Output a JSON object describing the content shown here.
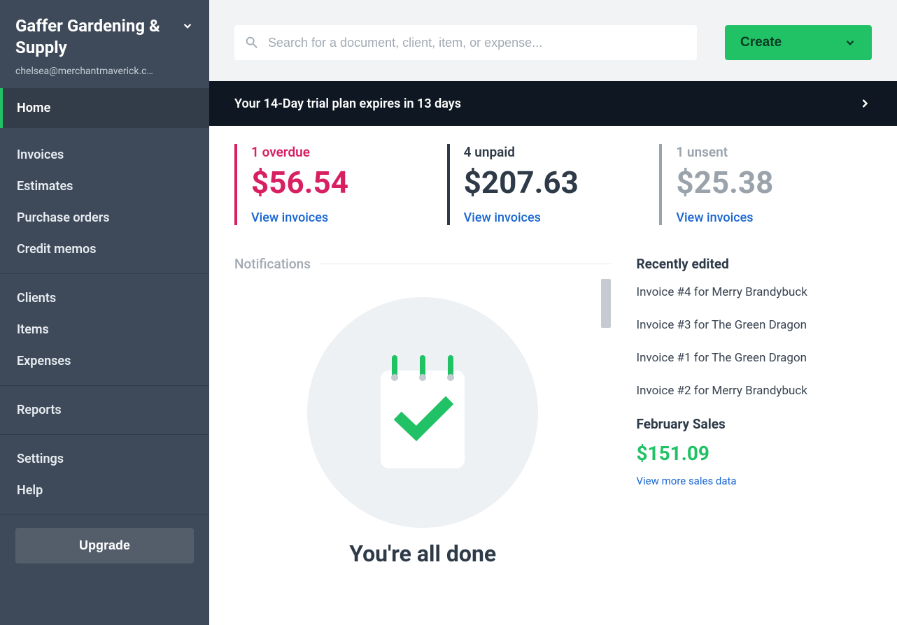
{
  "sidebar": {
    "company": "Gaffer Gardening & Supply",
    "email": "chelsea@merchantmaverick.c…",
    "nav": {
      "home": "Home",
      "invoices": "Invoices",
      "estimates": "Estimates",
      "purchase_orders": "Purchase orders",
      "credit_memos": "Credit memos",
      "clients": "Clients",
      "items": "Items",
      "expenses": "Expenses",
      "reports": "Reports",
      "settings": "Settings",
      "help": "Help"
    },
    "upgrade": "Upgrade"
  },
  "search": {
    "placeholder": "Search for a document, client, item, or expense..."
  },
  "create_label": "Create",
  "trial_banner": "Your 14-Day trial plan expires in 13 days",
  "stats": {
    "overdue": {
      "label": "1 overdue",
      "value": "$56.54",
      "link": "View invoices"
    },
    "unpaid": {
      "label": "4 unpaid",
      "value": "$207.63",
      "link": "View invoices"
    },
    "unsent": {
      "label": "1 unsent",
      "value": "$25.38",
      "link": "View invoices"
    }
  },
  "notifications": {
    "title": "Notifications",
    "done": "You're all done"
  },
  "recent": {
    "title": "Recently edited",
    "items": [
      "Invoice #4 for Merry Brandybuck",
      "Invoice #3 for The Green Dragon",
      "Invoice #1 for The Green Dragon",
      "Invoice #2 for Merry Brandybuck"
    ],
    "sales_title": "February Sales",
    "sales_value": "$151.09",
    "more": "View more sales data"
  }
}
